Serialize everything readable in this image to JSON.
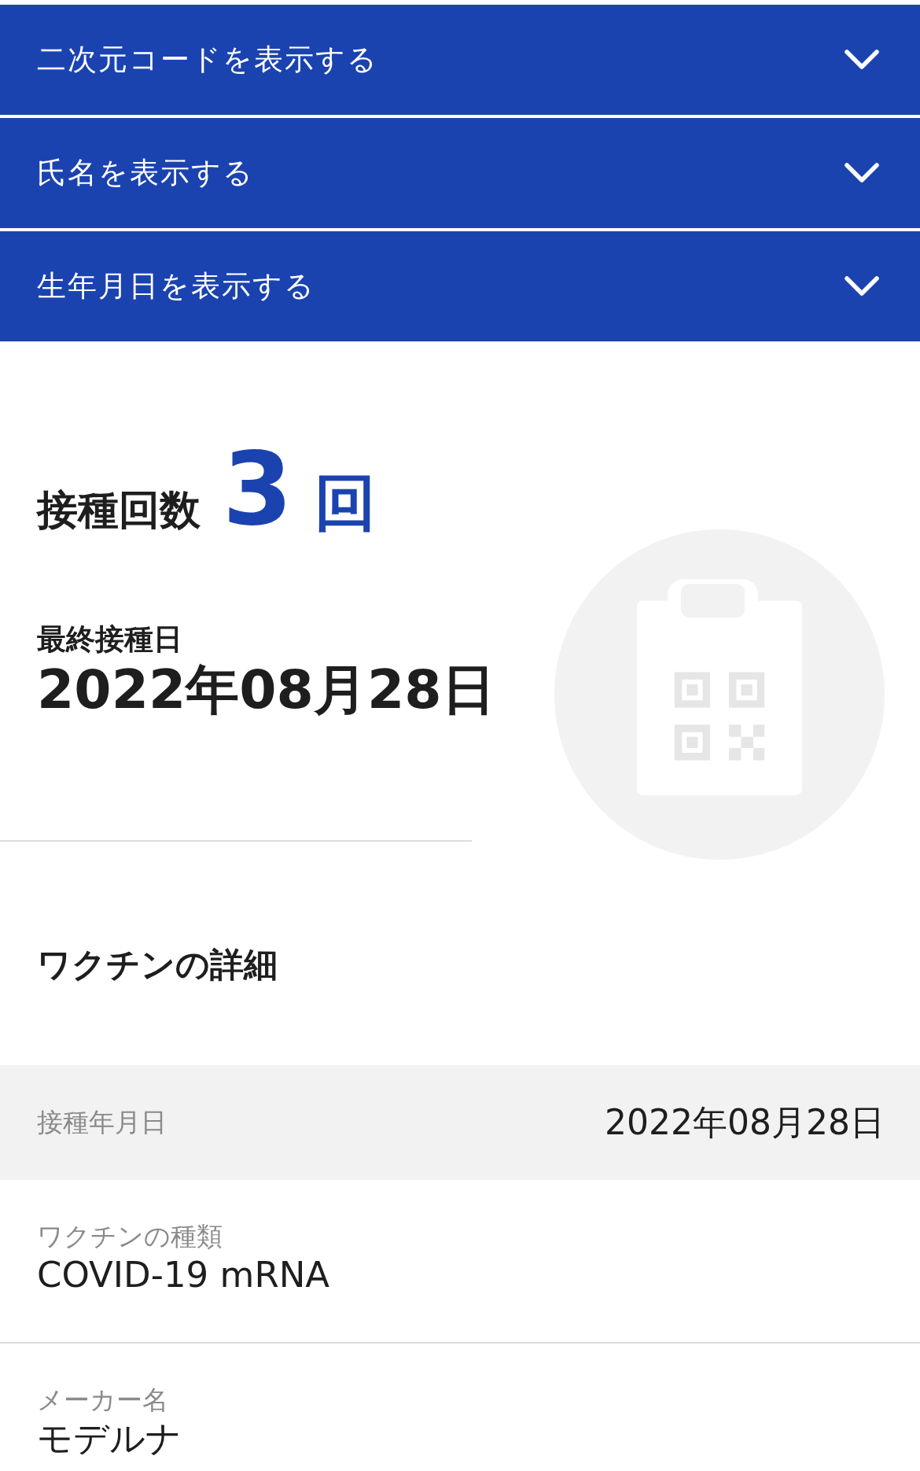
{
  "accordions": [
    {
      "label": "二次元コードを表示する",
      "expanded": false
    },
    {
      "label": "氏名を表示する",
      "expanded": false
    },
    {
      "label": "生年月日を表示する",
      "expanded": false
    }
  ],
  "summary": {
    "count_label": "接種回数",
    "count": "3",
    "count_unit": "回",
    "last_date_label": "最終接種日",
    "last_date": "2022年08月28日"
  },
  "details": {
    "title": "ワクチンの詳細",
    "rows": [
      {
        "kind": "inline",
        "label": "接種年月日",
        "value": "2022年08月28日",
        "highlighted": true
      },
      {
        "kind": "stacked",
        "label": "ワクチンの種類",
        "value": "COVID-19 mRNA",
        "highlighted": false
      },
      {
        "kind": "stacked",
        "label": "メーカー名",
        "value": "モデルナ",
        "highlighted": false
      }
    ]
  }
}
